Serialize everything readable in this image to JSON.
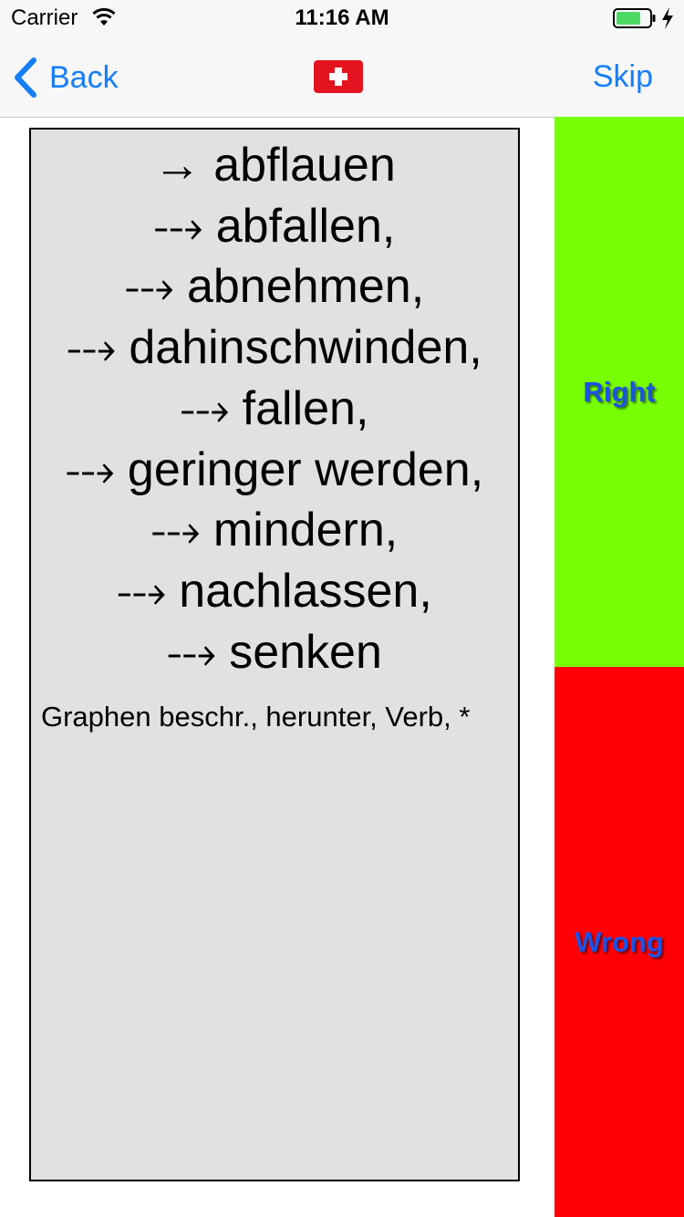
{
  "status_bar": {
    "carrier": "Carrier",
    "time": "11:16 AM"
  },
  "nav": {
    "back_label": "Back",
    "flag": "swiss-flag",
    "skip_label": "Skip"
  },
  "card": {
    "lines": [
      {
        "arrow": "→",
        "word": "abflauen"
      },
      {
        "arrow": "⤏",
        "word": "abfallen,"
      },
      {
        "arrow": "⤏",
        "word": "abnehmen,"
      },
      {
        "arrow": "⤏",
        "word": "dahinschwinden,"
      },
      {
        "arrow": "⤏",
        "word": "fallen,"
      },
      {
        "arrow": "⤏",
        "word": "geringer werden,"
      },
      {
        "arrow": "⤏",
        "word": "mindern,"
      },
      {
        "arrow": "⤏",
        "word": "nachlassen,"
      },
      {
        "arrow": "⤏",
        "word": "senken"
      }
    ],
    "tags": "Graphen beschr., herunter, Verb, *"
  },
  "buttons": {
    "right_label": "Right",
    "wrong_label": "Wrong"
  },
  "colors": {
    "right": "#77ff05",
    "wrong": "#ff0006",
    "tint": "#157efb",
    "card_bg": "#e1e1e1"
  }
}
